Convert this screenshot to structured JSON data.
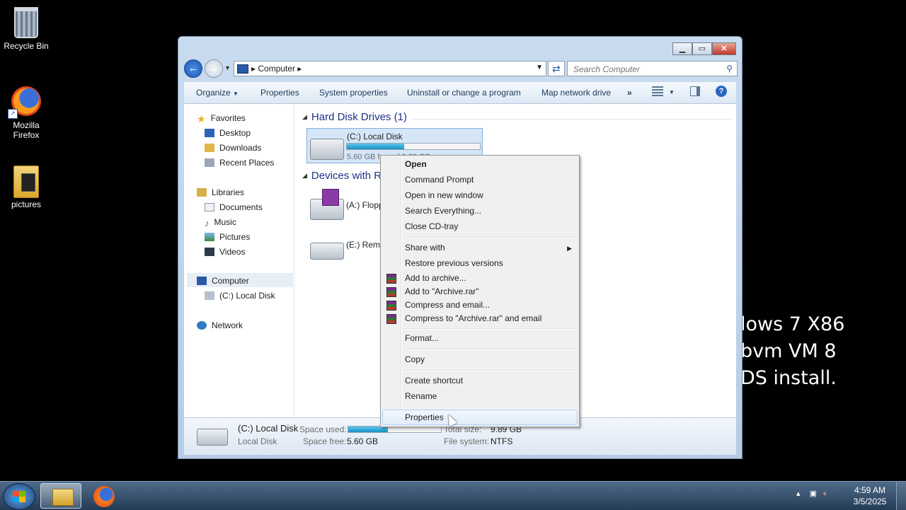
{
  "desktop": {
    "icons": [
      {
        "label": "Recycle Bin"
      },
      {
        "label_line1": "Mozilla",
        "label_line2": "Firefox"
      },
      {
        "label": "pictures"
      }
    ],
    "overlay_lines": [
      "lows 7 X86",
      "bvm VM 8",
      "DS install."
    ]
  },
  "window": {
    "address": {
      "crumb": "Computer"
    },
    "search": {
      "placeholder": "Search Computer"
    },
    "toolbar": {
      "organize": "Organize",
      "properties": "Properties",
      "system_properties": "System properties",
      "uninstall": "Uninstall or change a program",
      "map_drive": "Map network drive",
      "more": "»"
    },
    "nav": {
      "favorites": "Favorites",
      "desktop": "Desktop",
      "downloads": "Downloads",
      "recent": "Recent Places",
      "libraries": "Libraries",
      "documents": "Documents",
      "music": "Music",
      "pictures": "Pictures",
      "videos": "Videos",
      "computer": "Computer",
      "local_disk": "(C:) Local Disk",
      "network": "Network"
    },
    "sections": {
      "hdd_title": "Hard Disk Drives (1)",
      "removable_title": "Devices with Re"
    },
    "drives": {
      "c_name": "(C:) Local Disk",
      "c_free": "5.60 GB free of 9.89 GB",
      "c_used_fraction": 0.43,
      "a_name": "(A:) Flopp",
      "e_name": "(E:) Remo"
    },
    "details": {
      "name": "(C:) Local Disk",
      "type": "Local Disk",
      "space_used_label": "Space used:",
      "space_free_label": "Space free:",
      "space_free_value": "5.60 GB",
      "total_size_label": "Total size:",
      "total_size_value": "9.89 GB",
      "filesystem_label": "File system:",
      "filesystem_value": "NTFS"
    }
  },
  "context_menu": {
    "open": "Open",
    "cmd": "Command Prompt",
    "open_new": "Open in new window",
    "search_everything": "Search Everything...",
    "close_cd": "Close CD-tray",
    "share_with": "Share with",
    "restore": "Restore previous versions",
    "add_archive": "Add to archive...",
    "add_rar": "Add to \"Archive.rar\"",
    "compress_email": "Compress and email...",
    "compress_rar_email": "Compress to \"Archive.rar\" and email",
    "format": "Format...",
    "copy": "Copy",
    "create_shortcut": "Create shortcut",
    "rename": "Rename",
    "properties": "Properties"
  },
  "taskbar": {
    "time": "4:59 AM",
    "date": "3/5/2025"
  }
}
